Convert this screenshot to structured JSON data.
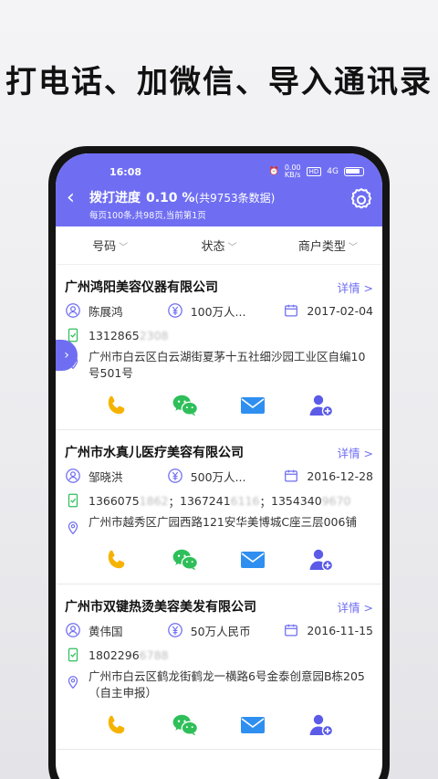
{
  "headline": "打电话、加微信、导入通讯录",
  "status_bar": {
    "time": "16:08",
    "net_speed": "0.00\nKB/s",
    "signal": "4G"
  },
  "header": {
    "title": "拨打进度",
    "percent": "0.10 %",
    "total": "(共9753条数据)",
    "note": "每页100条,共98页,当前第1页"
  },
  "filters": [
    "号码",
    "状态",
    "商户类型"
  ],
  "cards": [
    {
      "company": "广州鸿阳美容仪器有限公司",
      "detail": "详情 >",
      "person": "陈展鸿",
      "capital": "100万人...",
      "date": "2017-02-04",
      "phones": [
        {
          "visible": "1312865",
          "hidden": "2308"
        }
      ],
      "address": "广州市白云区白云湖街夏茅十五社细沙园工业区自编10号501号"
    },
    {
      "company": "广州市水真儿医疗美容有限公司",
      "detail": "详情 >",
      "person": "邹晓洪",
      "capital": "500万人...",
      "date": "2016-12-28",
      "phones": [
        {
          "visible": "1366075",
          "hidden": "1862"
        },
        {
          "visible": "1367241",
          "hidden": "6116"
        },
        {
          "visible": "1354340",
          "hidden": "9670"
        }
      ],
      "address": "广州市越秀区广园西路121安华美博城C座三层006铺"
    },
    {
      "company": "广州市双键热烫美容美发有限公司",
      "detail": "详情 >",
      "person": "黄伟国",
      "capital": "50万人民币",
      "date": "2016-11-15",
      "phones": [
        {
          "visible": "1802296",
          "hidden": "6788"
        }
      ],
      "address": "广州市白云区鹤龙街鹤龙一横路6号金泰创意园B栋205（自主申报）"
    }
  ],
  "colors": {
    "accent": "#6f6ef2",
    "phone": "#f5b300",
    "wechat": "#2fbf5a",
    "mail": "#2f8ff0",
    "contact": "#5b5be8"
  }
}
